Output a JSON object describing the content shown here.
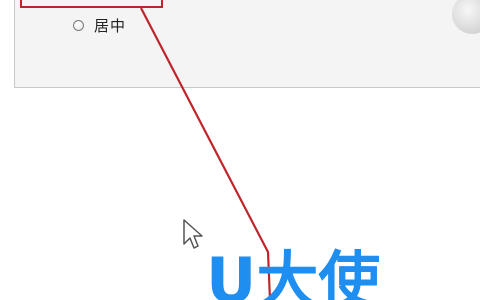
{
  "dialog": {
    "option_label": "居中"
  },
  "icons": {
    "radio": "radio-unselected-icon",
    "cursor": "arrow-cursor-icon",
    "button": "round-button-icon"
  },
  "colors": {
    "annotation": "#c0242a",
    "watermark": "#1e8ef0"
  },
  "watermark": {
    "text": "U大使"
  }
}
